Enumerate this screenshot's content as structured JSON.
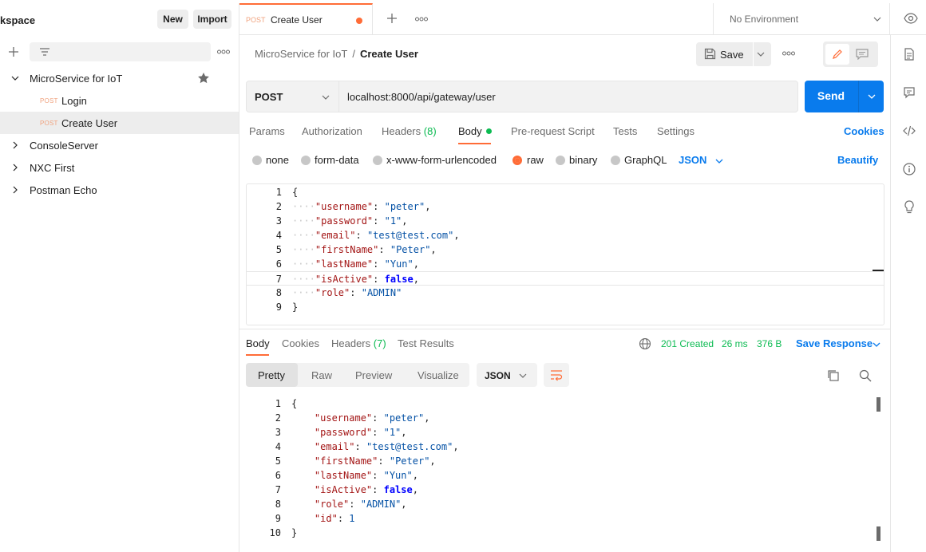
{
  "sidebar": {
    "workspace_title": "kspace",
    "new_label": "New",
    "import_label": "Import",
    "collections": [
      {
        "label": "MicroService for IoT",
        "expanded": true,
        "starred": true,
        "requests": [
          {
            "method": "POST",
            "label": "Login",
            "active": false
          },
          {
            "method": "POST",
            "label": "Create User",
            "active": true
          }
        ]
      },
      {
        "label": "ConsoleServer",
        "expanded": false
      },
      {
        "label": "NXC First",
        "expanded": false
      },
      {
        "label": "Postman Echo",
        "expanded": false
      }
    ]
  },
  "tabbar": {
    "active_tab": {
      "method": "POST",
      "name": "Create User",
      "unsaved": true
    },
    "environment": "No Environment"
  },
  "request": {
    "breadcrumb_parent": "MicroService for IoT",
    "breadcrumb_sep": "/",
    "breadcrumb_current": "Create User",
    "save_label": "Save",
    "method": "POST",
    "url": "localhost:8000/api/gateway/user",
    "send_label": "Send",
    "tabs": {
      "params": "Params",
      "authorization": "Authorization",
      "headers": "Headers",
      "headers_count": "(8)",
      "body": "Body",
      "prerequest": "Pre-request Script",
      "tests": "Tests",
      "settings": "Settings"
    },
    "cookies_label": "Cookies",
    "body_types": {
      "none": "none",
      "form_data": "form-data",
      "urlencoded": "x-www-form-urlencoded",
      "raw": "raw",
      "binary": "binary",
      "graphql": "GraphQL"
    },
    "selected_body_type": "raw",
    "language": "JSON",
    "beautify_label": "Beautify",
    "body_lines": [
      {
        "no": "1",
        "pre": "",
        "key": "",
        "val": "",
        "bool": "",
        "post": "{"
      },
      {
        "no": "2",
        "pre": "····",
        "key": "\"username\"",
        "val": "\"peter\"",
        "bool": "",
        "post": ","
      },
      {
        "no": "3",
        "pre": "····",
        "key": "\"password\"",
        "val": "\"1\"",
        "bool": "",
        "post": ","
      },
      {
        "no": "4",
        "pre": "····",
        "key": "\"email\"",
        "val": "\"test@test.com\"",
        "bool": "",
        "post": ","
      },
      {
        "no": "5",
        "pre": "····",
        "key": "\"firstName\"",
        "val": "\"Peter\"",
        "bool": "",
        "post": ","
      },
      {
        "no": "6",
        "pre": "····",
        "key": "\"lastName\"",
        "val": "\"Yun\"",
        "bool": "",
        "post": ","
      },
      {
        "no": "7",
        "pre": "····",
        "key": "\"isActive\"",
        "val": "",
        "bool": "false",
        "post": ","
      },
      {
        "no": "8",
        "pre": "····",
        "key": "\"role\"",
        "val": "\"ADMIN\"",
        "bool": "",
        "post": ""
      },
      {
        "no": "9",
        "pre": "",
        "key": "",
        "val": "",
        "bool": "",
        "post": "}"
      }
    ]
  },
  "response": {
    "tabs": {
      "body": "Body",
      "cookies": "Cookies",
      "headers": "Headers",
      "headers_count": "(7)",
      "test_results": "Test Results"
    },
    "status": "201 Created",
    "time": "26 ms",
    "size": "376 B",
    "save_response_label": "Save Response",
    "view_modes": {
      "pretty": "Pretty",
      "raw": "Raw",
      "preview": "Preview",
      "visualize": "Visualize"
    },
    "format": "JSON",
    "body_lines": [
      {
        "no": "1",
        "pre": "",
        "key": "",
        "val": "",
        "bool": "",
        "post": "{"
      },
      {
        "no": "2",
        "pre": "    ",
        "key": "\"username\"",
        "val": "\"peter\"",
        "bool": "",
        "post": ","
      },
      {
        "no": "3",
        "pre": "    ",
        "key": "\"password\"",
        "val": "\"1\"",
        "bool": "",
        "post": ","
      },
      {
        "no": "4",
        "pre": "    ",
        "key": "\"email\"",
        "val": "\"test@test.com\"",
        "bool": "",
        "post": ","
      },
      {
        "no": "5",
        "pre": "    ",
        "key": "\"firstName\"",
        "val": "\"Peter\"",
        "bool": "",
        "post": ","
      },
      {
        "no": "6",
        "pre": "    ",
        "key": "\"lastName\"",
        "val": "\"Yun\"",
        "bool": "",
        "post": ","
      },
      {
        "no": "7",
        "pre": "    ",
        "key": "\"isActive\"",
        "val": "",
        "bool": "false",
        "post": ","
      },
      {
        "no": "8",
        "pre": "    ",
        "key": "\"role\"",
        "val": "\"ADMIN\"",
        "bool": "",
        "post": ","
      },
      {
        "no": "9",
        "pre": "    ",
        "key": "\"id\"",
        "val": "1",
        "bool": "",
        "post": ""
      },
      {
        "no": "10",
        "pre": "",
        "key": "",
        "val": "",
        "bool": "",
        "post": "}"
      }
    ]
  },
  "colors": {
    "accent": "#ff6c37",
    "primary": "#097bed",
    "success": "#0cbb52",
    "json_key": "#a31515",
    "json_string": "#0451a5",
    "json_bool": "#0000ff"
  }
}
